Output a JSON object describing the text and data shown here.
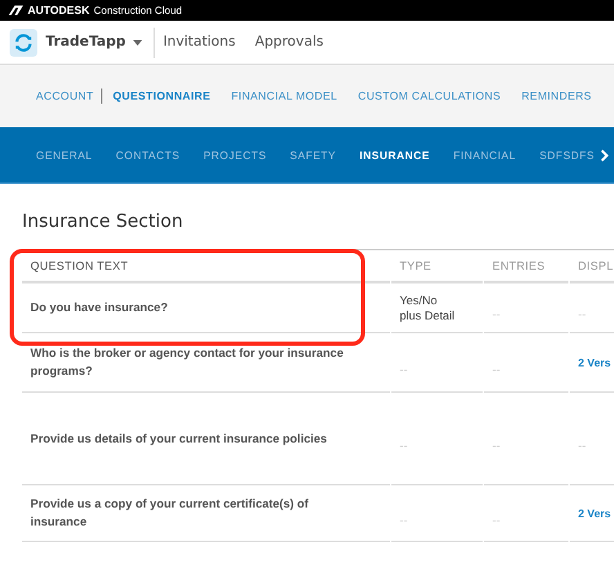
{
  "topbar": {
    "brand": "AUTODESK",
    "product": "Construction Cloud"
  },
  "header": {
    "app": "TradeTapp",
    "links": [
      {
        "label": "Invitations"
      },
      {
        "label": "Approvals"
      }
    ]
  },
  "nav": [
    {
      "label": "ACCOUNT",
      "selected": false
    },
    {
      "label": "QUESTIONNAIRE",
      "selected": true
    },
    {
      "label": "FINANCIAL MODEL",
      "selected": false
    },
    {
      "label": "CUSTOM CALCULATIONS",
      "selected": false
    },
    {
      "label": "REMINDERS",
      "selected": false
    }
  ],
  "tabs": [
    {
      "label": "GENERAL",
      "selected": false
    },
    {
      "label": "CONTACTS",
      "selected": false
    },
    {
      "label": "PROJECTS",
      "selected": false
    },
    {
      "label": "SAFETY",
      "selected": false
    },
    {
      "label": "INSURANCE",
      "selected": true
    },
    {
      "label": "FINANCIAL",
      "selected": false
    },
    {
      "label": "SDFSDFS",
      "selected": false
    }
  ],
  "section_title": "Insurance Section",
  "table": {
    "columns": [
      "QUESTION TEXT",
      "TYPE",
      "ENTRIES",
      "DISPL"
    ],
    "rows": [
      {
        "cells": [
          "Do you have insurance?",
          "Yes/No\nplus Detail",
          "--",
          "--"
        ],
        "link": false
      },
      {
        "cells": [
          "Who is the broker or agency contact for your insurance programs?",
          "--",
          "--",
          "2 Vers"
        ],
        "link": true
      },
      {
        "cells": [
          "Provide us details of your current insurance policies",
          "--",
          "--",
          "--"
        ],
        "link": false
      },
      {
        "cells": [
          "Provide us a copy of your current certificate(s) of insurance",
          "--",
          "--",
          "2 Vers"
        ],
        "link": true
      }
    ]
  },
  "annotation": {
    "kind": "highlight-box",
    "color": "#ff2a1a"
  }
}
